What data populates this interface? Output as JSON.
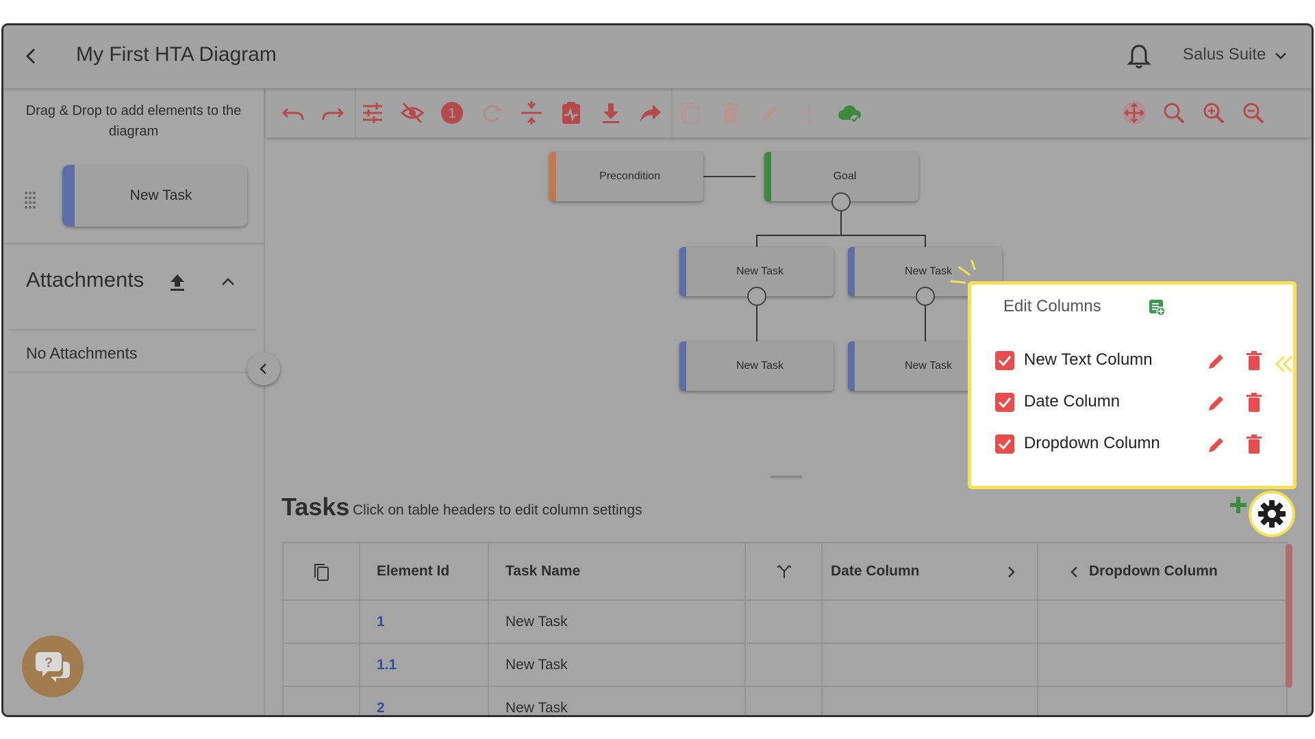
{
  "app": {
    "title": "My First HTA Diagram",
    "suite_label": "Salus Suite"
  },
  "sidebar": {
    "dnd_hint": "Drag & Drop to add elements to the diagram",
    "palette_task_label": "New Task",
    "attachments_title": "Attachments",
    "no_attachments": "No Attachments"
  },
  "toolbar": {
    "icons": [
      "undo-icon",
      "redo-icon",
      "tune-icon",
      "visibility-off-icon",
      "alert-badge-icon",
      "refresh-icon",
      "split-icon",
      "clipboard-pulse-icon",
      "download-icon",
      "share-icon",
      "copy-icon",
      "delete-icon",
      "edit-icon",
      "exclamation-icon",
      "cloud-check-icon",
      "move-icon",
      "search-icon",
      "zoom-in-icon",
      "zoom-out-icon"
    ]
  },
  "diagram": {
    "precondition": "Precondition",
    "goal": "Goal",
    "tasks": [
      "New Task",
      "New Task",
      "New Task",
      "New Task"
    ]
  },
  "tasks_panel": {
    "title": "Tasks",
    "hint": "Click on table headers to edit column settings",
    "columns": [
      "Element Id",
      "Task Name",
      "Date Column",
      "Dropdown Column"
    ],
    "rows": [
      {
        "id": "1",
        "name": "New Task"
      },
      {
        "id": "1.1",
        "name": "New Task"
      },
      {
        "id": "2",
        "name": "New Task"
      }
    ]
  },
  "edit_columns": {
    "title": "Edit Columns",
    "items": [
      {
        "label": "New Text Column",
        "checked": true
      },
      {
        "label": "Date Column",
        "checked": true
      },
      {
        "label": "Dropdown Column",
        "checked": true
      }
    ]
  },
  "colors": {
    "accent_red": "#e84c4c",
    "highlight_yellow": "#f5e153",
    "task_blue": "#5d6ea6",
    "goal_green": "#3c8a3c",
    "precondition_orange": "#c5774c"
  }
}
